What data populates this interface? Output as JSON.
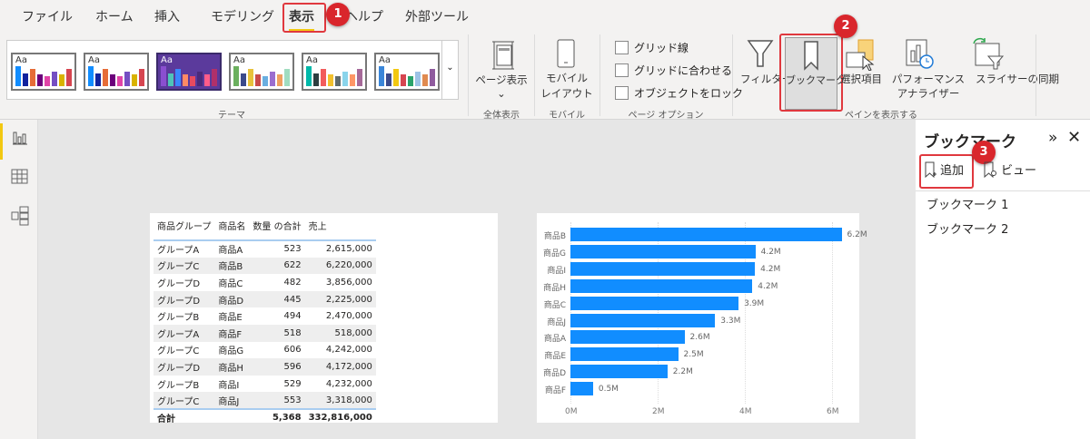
{
  "menu": {
    "tabs": [
      "ファイル",
      "ホーム",
      "挿入",
      "モデリング",
      "表示",
      "ヘルプ",
      "外部ツール"
    ],
    "active": "表示"
  },
  "ribbon": {
    "theme_group": "テーマ",
    "theme_text": "Aa",
    "themes": [
      {
        "bg": "#ffffff",
        "colors": [
          "#118dff",
          "#12239e",
          "#e66c37",
          "#6b007b",
          "#e044a7",
          "#744ec2",
          "#d9b300",
          "#d64550"
        ]
      },
      {
        "bg": "#ffffff",
        "colors": [
          "#118dff",
          "#12239e",
          "#e66c37",
          "#6b007b",
          "#e044a7",
          "#744ec2",
          "#d9b300",
          "#d64550"
        ]
      },
      {
        "bg": "#5b3a9c",
        "colors": [
          "#8a4fd0",
          "#4fc3b8",
          "#3a86ff",
          "#ff8a65",
          "#e84a5f",
          "#4a2a7a",
          "#ff5c8a",
          "#b0306a"
        ]
      },
      {
        "bg": "#ffffff",
        "colors": [
          "#6bb05e",
          "#3b4a8a",
          "#e8c23c",
          "#c94a4a",
          "#6aaee0",
          "#9b6ecf",
          "#f0a060",
          "#a0dcc0"
        ]
      },
      {
        "bg": "#ffffff",
        "colors": [
          "#00b8a9",
          "#2d3e40",
          "#f25c5c",
          "#f2c12e",
          "#5f6b6d",
          "#8ad4eb",
          "#fe9666",
          "#a66999"
        ]
      },
      {
        "bg": "#ffffff",
        "colors": [
          "#3a86d9",
          "#3b4a8a",
          "#f2c811",
          "#d64550",
          "#2ba36b",
          "#9dc3e6",
          "#e08a50",
          "#8f5b9e"
        ]
      }
    ],
    "page_view": "ページ表示",
    "fit_group": "全体表示",
    "mobile_layout": [
      "モバイル",
      "レイアウト"
    ],
    "mobile_group": "モバイル",
    "checkboxes": [
      "グリッド線",
      "グリッドに合わせる",
      "オブジェクトをロック"
    ],
    "page_options_group": "ページ オプション",
    "panes": [
      "フィルター",
      "ブックマーク",
      "選択項目",
      "パフォーマンス",
      "スライサーの同期"
    ],
    "perf_line2": "アナライザー",
    "panes_group": "ペインを表示する"
  },
  "badges": [
    "1",
    "2",
    "3"
  ],
  "bookmark_pane": {
    "title": "ブックマーク",
    "add": "追加",
    "view": "ビュー",
    "items": [
      "ブックマーク 1",
      "ブックマーク 2"
    ]
  },
  "table": {
    "headers": [
      "商品グループ",
      "商品名",
      "数量 の合計",
      "売上"
    ],
    "rows": [
      [
        "グループA",
        "商品A",
        "523",
        "2,615,000"
      ],
      [
        "グループC",
        "商品B",
        "622",
        "6,220,000"
      ],
      [
        "グループD",
        "商品C",
        "482",
        "3,856,000"
      ],
      [
        "グループD",
        "商品D",
        "445",
        "2,225,000"
      ],
      [
        "グループB",
        "商品E",
        "494",
        "2,470,000"
      ],
      [
        "グループA",
        "商品F",
        "518",
        "518,000"
      ],
      [
        "グループC",
        "商品G",
        "606",
        "4,242,000"
      ],
      [
        "グループD",
        "商品H",
        "596",
        "4,172,000"
      ],
      [
        "グループB",
        "商品I",
        "529",
        "4,232,000"
      ],
      [
        "グループC",
        "商品J",
        "553",
        "3,318,000"
      ]
    ],
    "total": [
      "合計",
      "",
      "5,368",
      "332,816,000"
    ]
  },
  "chart_data": {
    "type": "bar",
    "orientation": "horizontal",
    "categories": [
      "商品B",
      "商品G",
      "商品I",
      "商品H",
      "商品C",
      "商品J",
      "商品A",
      "商品E",
      "商品D",
      "商品F"
    ],
    "values": [
      6220000,
      4242000,
      4232000,
      4172000,
      3856000,
      3318000,
      2615000,
      2470000,
      2225000,
      518000
    ],
    "data_labels": [
      "6.2M",
      "4.2M",
      "4.2M",
      "4.2M",
      "3.9M",
      "3.3M",
      "2.6M",
      "2.5M",
      "2.2M",
      "0.5M"
    ],
    "xticks": [
      "0M",
      "2M",
      "4M",
      "6M"
    ],
    "xlim": [
      0,
      6000000
    ],
    "color": "#118dff",
    "grid": true
  }
}
